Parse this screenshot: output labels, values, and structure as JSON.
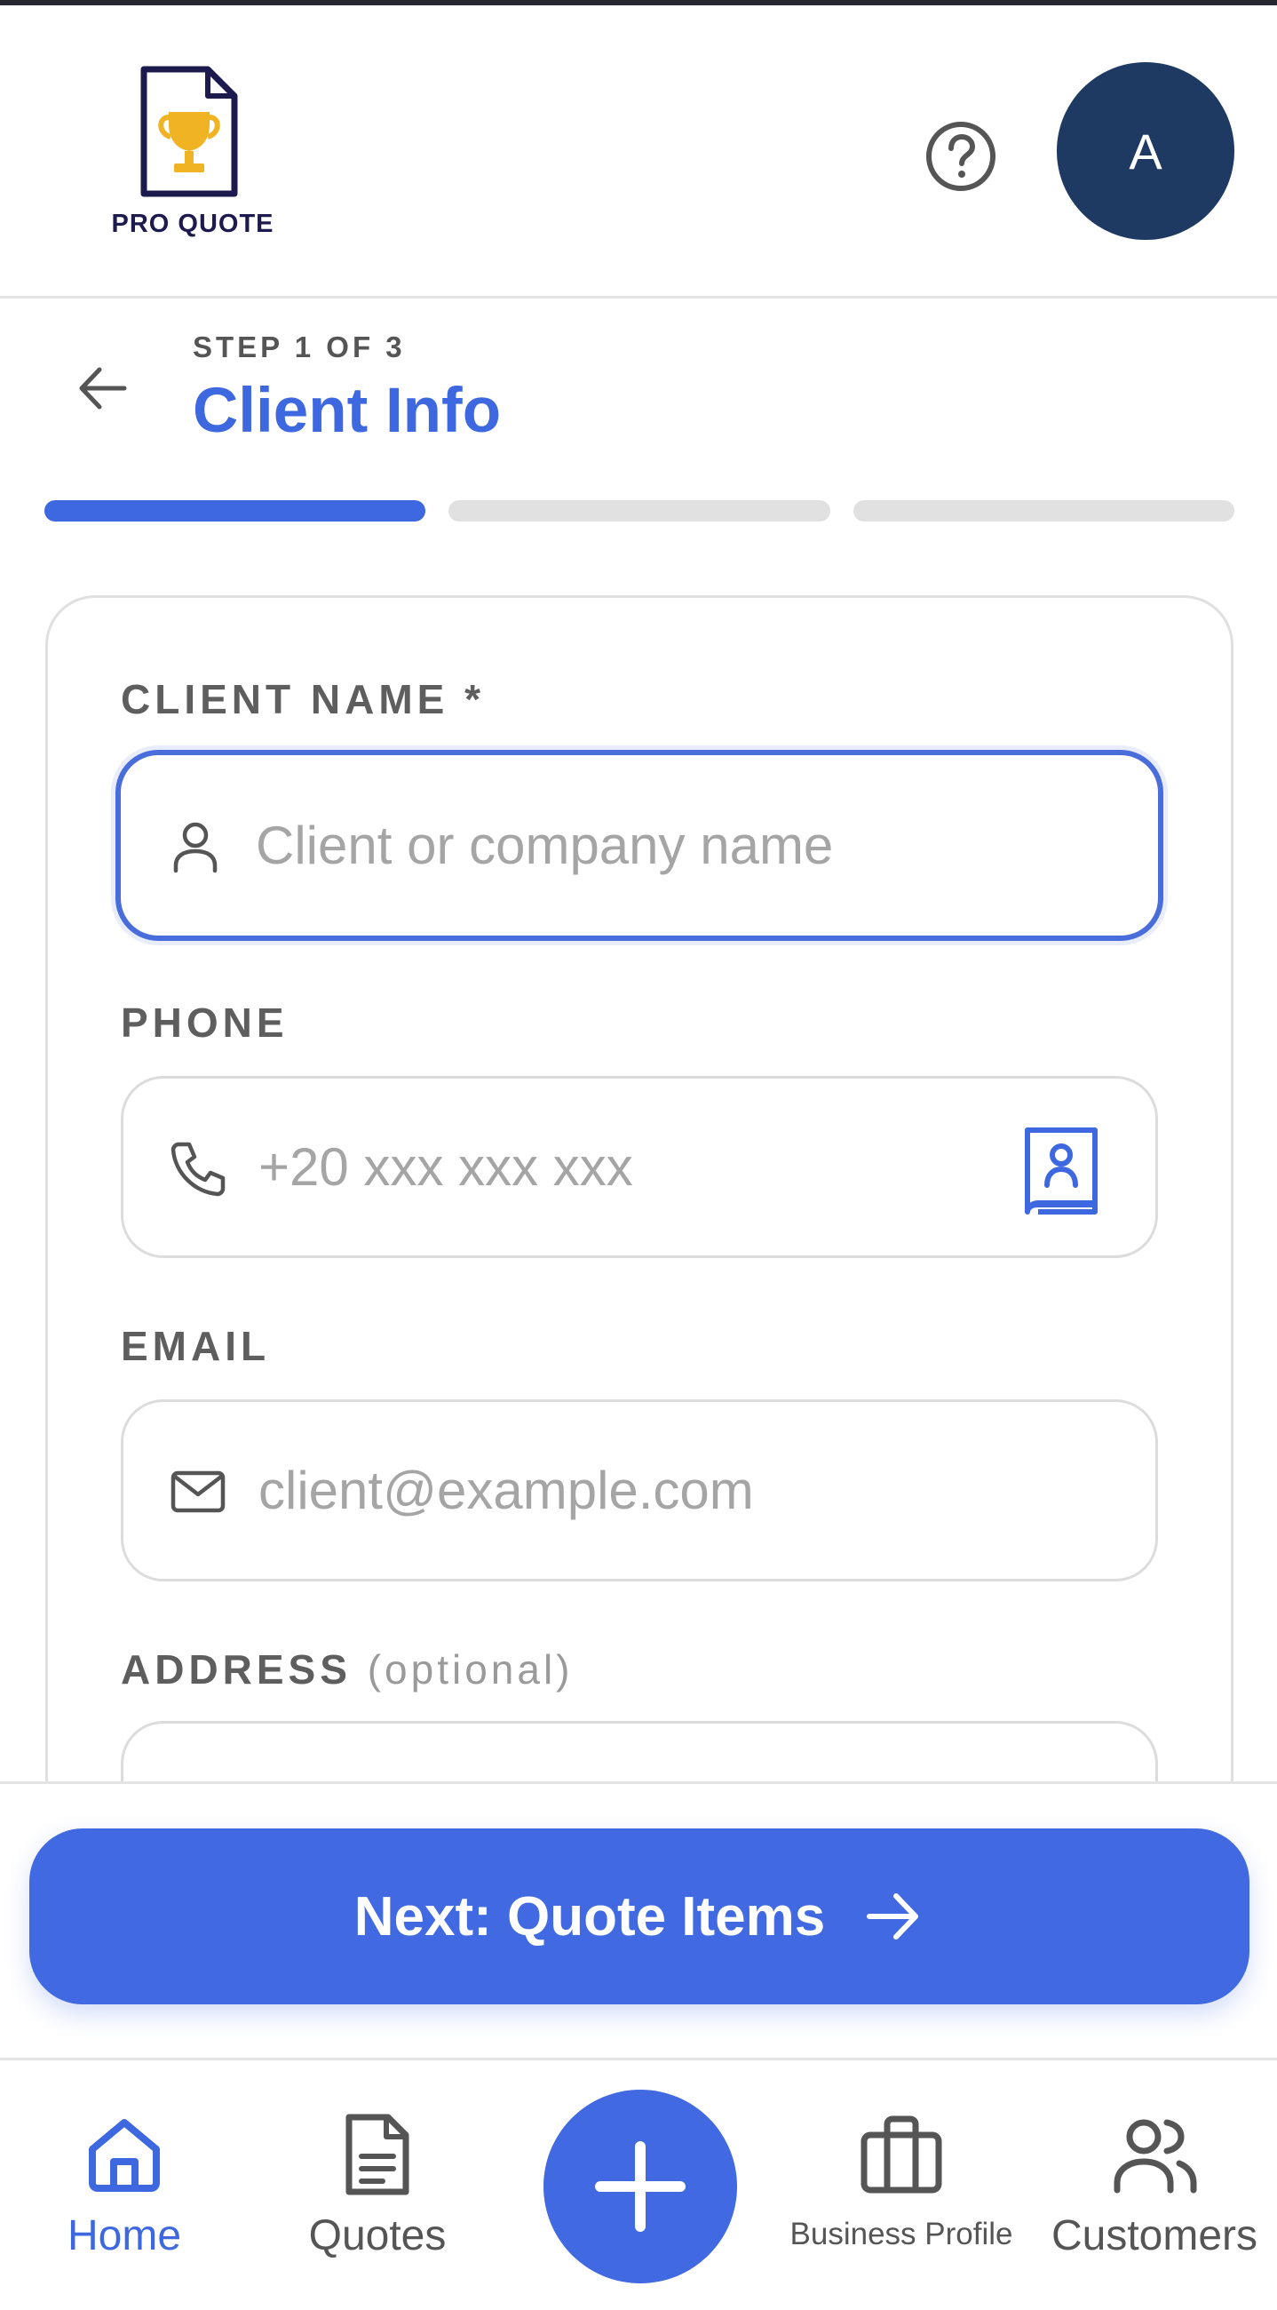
{
  "brand": {
    "name": "PRO QUOTE"
  },
  "header": {
    "avatar_initial": "A"
  },
  "step": {
    "label": "STEP 1 OF 3",
    "title": "Client Info",
    "total": 3,
    "current": 1
  },
  "form": {
    "client_name": {
      "label": "CLIENT NAME *",
      "placeholder": "Client or company name",
      "icon": "person-icon"
    },
    "phone": {
      "label": "PHONE",
      "placeholder": "+20 xxx xxx xxx",
      "icon": "phone-icon",
      "trailing_icon": "contacts-book-icon"
    },
    "email": {
      "label": "EMAIL",
      "placeholder": "client@example.com",
      "icon": "mail-icon"
    },
    "address": {
      "label": "ADDRESS",
      "optional_label": "(optional)"
    }
  },
  "next_button": {
    "label": "Next: Quote Items"
  },
  "nav": {
    "items": [
      {
        "label": "Home",
        "icon": "home-icon",
        "active": true
      },
      {
        "label": "Quotes",
        "icon": "document-icon"
      },
      {
        "label": "Business Profile",
        "icon": "briefcase-icon"
      },
      {
        "label": "Customers",
        "icon": "users-icon"
      }
    ]
  },
  "colors": {
    "accent": "#4169e1",
    "title": "#3d68df",
    "avatar_bg": "#1f3a62",
    "trophy": "#f0b323"
  }
}
